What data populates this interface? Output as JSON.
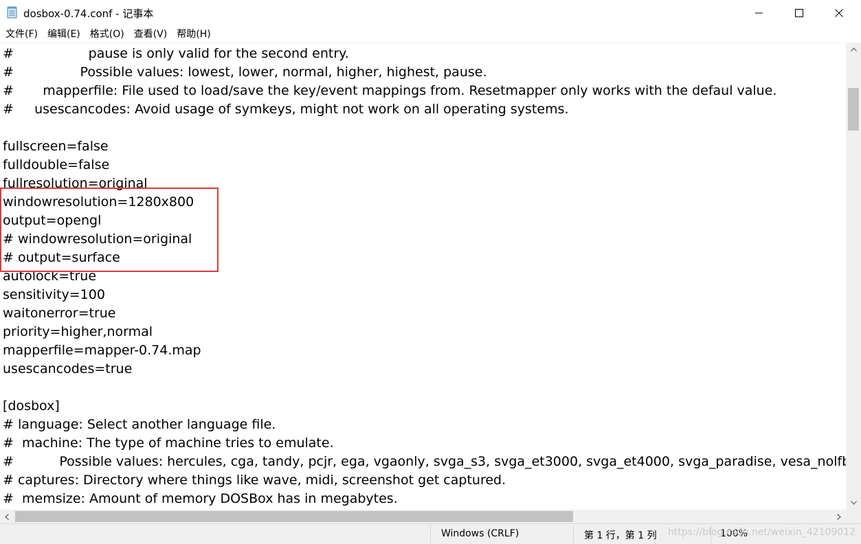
{
  "window": {
    "title": "dosbox-0.74.conf - 记事本"
  },
  "menu": [
    "文件(F)",
    "编辑(E)",
    "格式(O)",
    "查看(V)",
    "帮助(H)"
  ],
  "editor": {
    "lines": [
      "#                  pause is only valid for the second entry.",
      "#                Possible values: lowest, lower, normal, higher, highest, pause.",
      "#       mapperfile: File used to load/save the key/event mappings from. Resetmapper only works with the defaul value.",
      "#     usescancodes: Avoid usage of symkeys, might not work on all operating systems.",
      "",
      "fullscreen=false",
      "fulldouble=false",
      "fullresolution=original",
      "windowresolution=1280x800",
      "output=opengl",
      "# windowresolution=original",
      "# output=surface",
      "autolock=true",
      "sensitivity=100",
      "waitonerror=true",
      "priority=higher,normal",
      "mapperfile=mapper-0.74.map",
      "usescancodes=true",
      "",
      "[dosbox]",
      "# language: Select another language file.",
      "#  machine: The type of machine tries to emulate.",
      "#           Possible values: hercules, cga, tandy, pcjr, ega, vgaonly, svga_s3, svga_et3000, svga_et4000, svga_paradise, vesa_nolfb, v",
      "# captures: Directory where things like wave, midi, screenshot get captured.",
      "#  memsize: Amount of memory DOSBox has in megabytes."
    ]
  },
  "status": {
    "encoding": "Windows (CRLF)",
    "position": "第 1 行，第 1 列",
    "zoom": "100%",
    "watermark": "https://blog.csdn.net/weixin_42109012"
  },
  "colors": {
    "highlight": "#e0393b",
    "scrollbar_thumb": "#c2c2c2",
    "chrome": "#f0f0f0"
  }
}
